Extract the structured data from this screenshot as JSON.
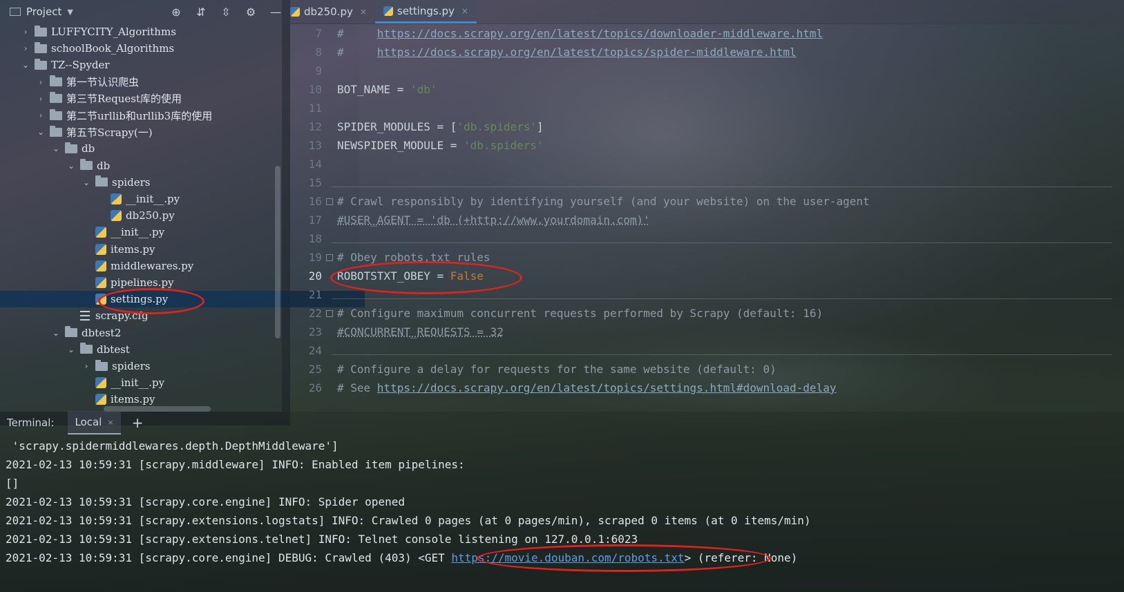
{
  "project_panel": {
    "title": "Project",
    "tools": [
      "crosshair-icon",
      "expand-all-icon",
      "collapse-all-icon",
      "gear-icon",
      "minimize-icon"
    ],
    "tree": [
      {
        "label": "LUFFYCITY_Algorithms",
        "type": "folder",
        "expanded": false
      },
      {
        "label": "schoolBook_Algorithms",
        "type": "folder",
        "expanded": false
      },
      {
        "label": "TZ--Spyder",
        "type": "folder",
        "expanded": true
      },
      {
        "label": "第一节认识爬虫",
        "type": "folder",
        "expanded": false
      },
      {
        "label": "第三节Request库的使用",
        "type": "folder",
        "expanded": false
      },
      {
        "label": "第二节urllib和urllib3库的使用",
        "type": "folder",
        "expanded": false
      },
      {
        "label": "第五节Scrapy(一)",
        "type": "folder",
        "expanded": true
      },
      {
        "label": "db",
        "type": "folder",
        "expanded": true
      },
      {
        "label": "db",
        "type": "package",
        "expanded": true
      },
      {
        "label": "spiders",
        "type": "package",
        "expanded": true
      },
      {
        "label": "__init__.py",
        "type": "py"
      },
      {
        "label": "db250.py",
        "type": "py"
      },
      {
        "label": "__init__.py",
        "type": "py"
      },
      {
        "label": "items.py",
        "type": "py"
      },
      {
        "label": "middlewares.py",
        "type": "py"
      },
      {
        "label": "pipelines.py",
        "type": "py"
      },
      {
        "label": "settings.py",
        "type": "py",
        "selected": true
      },
      {
        "label": "scrapy.cfg",
        "type": "cfg"
      },
      {
        "label": "dbtest2",
        "type": "folder",
        "expanded": true
      },
      {
        "label": "dbtest",
        "type": "package",
        "expanded": true
      },
      {
        "label": "spiders",
        "type": "package",
        "expanded": false
      },
      {
        "label": "__init__.py",
        "type": "py"
      },
      {
        "label": "items.py",
        "type": "py"
      }
    ]
  },
  "editor": {
    "tabs": [
      {
        "label": "db250.py",
        "active": false
      },
      {
        "label": "settings.py",
        "active": true
      }
    ],
    "current_line": "20",
    "lines": [
      {
        "num": "7",
        "text": "#     https://docs.scrapy.org/en/latest/topics/downloader-middleware.html"
      },
      {
        "num": "8",
        "text": "#     https://docs.scrapy.org/en/latest/topics/spider-middleware.html"
      },
      {
        "num": "9",
        "text": ""
      },
      {
        "num": "10",
        "text": "BOT_NAME = 'db'"
      },
      {
        "num": "11",
        "text": ""
      },
      {
        "num": "12",
        "text": "SPIDER_MODULES = ['db.spiders']"
      },
      {
        "num": "13",
        "text": "NEWSPIDER_MODULE = 'db.spiders'"
      },
      {
        "num": "14",
        "text": ""
      },
      {
        "num": "15",
        "text": ""
      },
      {
        "num": "16",
        "text": "# Crawl responsibly by identifying yourself (and your website) on the user-agent"
      },
      {
        "num": "17",
        "text": "#USER_AGENT = 'db (+http://www.yourdomain.com)'"
      },
      {
        "num": "18",
        "text": ""
      },
      {
        "num": "19",
        "text": "# Obey robots.txt rules"
      },
      {
        "num": "20",
        "text": "ROBOTSTXT_OBEY = False"
      },
      {
        "num": "21",
        "text": ""
      },
      {
        "num": "22",
        "text": "# Configure maximum concurrent requests performed by Scrapy (default: 16)"
      },
      {
        "num": "23",
        "text": "#CONCURRENT_REQUESTS = 32"
      },
      {
        "num": "24",
        "text": ""
      },
      {
        "num": "25",
        "text": "# Configure a delay for requests for the same website (default: 0)"
      },
      {
        "num": "26",
        "text": "# See https://docs.scrapy.org/en/latest/topics/settings.html#download-delay"
      }
    ],
    "tokens": {
      "l7_prefix": "#     ",
      "l7_link": "https://docs.scrapy.org/en/latest/topics/downloader-middleware.html",
      "l8_prefix": "#     ",
      "l8_link": "https://docs.scrapy.org/en/latest/topics/spider-middleware.html",
      "l10_a": "BOT_NAME = ",
      "l10_b": "'db'",
      "l12_a": "SPIDER_MODULES = [",
      "l12_b": "'db.spiders'",
      "l12_c": "]",
      "l13_a": "NEWSPIDER_MODULE = ",
      "l13_b": "'db.spiders'",
      "l16": "# Crawl responsibly by identifying yourself (and your website) on the user-agent",
      "l17": "#USER_AGENT = 'db (+http://www.yourdomain.com)'",
      "l19": "# Obey robots.txt rules",
      "l20_a": "ROBOTSTXT_OBEY = ",
      "l20_b": "False",
      "l22": "# Configure maximum concurrent requests performed by Scrapy (default: 16)",
      "l23": "#CONCURRENT_REQUESTS = 32",
      "l25": "# Configure a delay for requests for the same website (default: 0)",
      "l26_prefix": "# See ",
      "l26_link": "https://docs.scrapy.org/en/latest/topics/settings.html#download-delay"
    }
  },
  "terminal": {
    "label": "Terminal:",
    "tab": "Local",
    "lines": [
      " 'scrapy.spidermiddlewares.depth.DepthMiddleware']",
      "2021-02-13 10:59:31 [scrapy.middleware] INFO: Enabled item pipelines:",
      "[]",
      "2021-02-13 10:59:31 [scrapy.core.engine] INFO: Spider opened",
      "2021-02-13 10:59:31 [scrapy.extensions.logstats] INFO: Crawled 0 pages (at 0 pages/min), scraped 0 items (at 0 items/min)",
      "2021-02-13 10:59:31 [scrapy.extensions.telnet] INFO: Telnet console listening on 127.0.0.1:6023"
    ],
    "last_line": {
      "prefix": "2021-02-13 10:59:31 [scrapy.core.engine] DEBUG: Crawled (403) <GET ",
      "link": "https://movie.douban.com/robots.txt",
      "suffix": "> (referer: None)"
    }
  },
  "colors": {
    "annotation": "#e0221c",
    "selection": "#123454",
    "keyword": "#cc7832",
    "string": "#6a8759",
    "terminal_link": "#5c9ee6"
  }
}
